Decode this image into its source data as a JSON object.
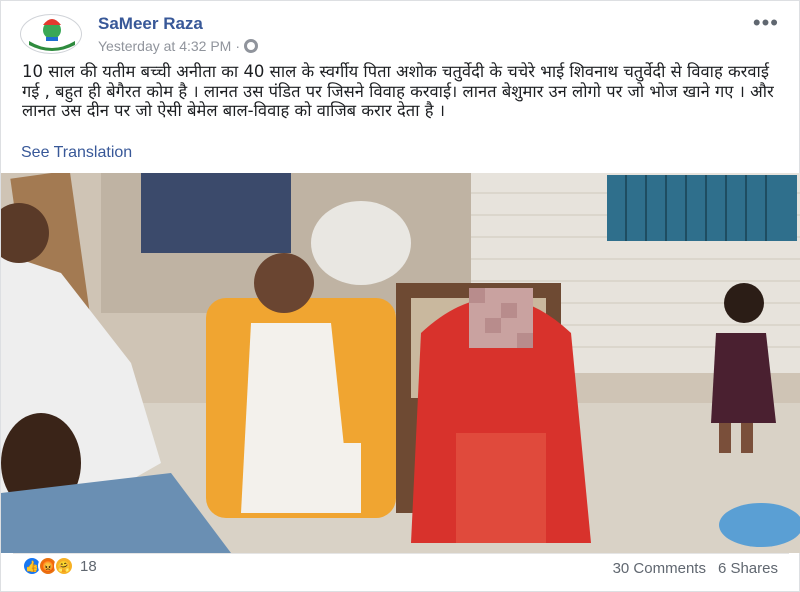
{
  "post": {
    "author": "SaMeer Raza",
    "timestamp": "Yesterday at 4:32 PM",
    "separator": "·",
    "privacy_icon": "globe-icon",
    "more_icon": "more-options-icon",
    "more_label": "•••",
    "text": "10 साल की यतीम बच्ची अनीता का 40 साल के स्वर्गीय पिता अशोक चतुर्वेदी के चचेरे भाई शिवनाथ चतुर्वेदी से विवाह करवाई गई , बहुत ही बेगैरत कोम है । लानत उस पंडित पर जिसने विवाह करवाई। लानत बेशुमार उन लोगो पर जो भोज खाने गए । और लानत उस दीन पर जो ऐसी बेमेल बाल-विवाह को वाजिब करार देता है ।",
    "see_translation": "See Translation"
  },
  "photo": {
    "icon": "post-photo"
  },
  "footer": {
    "reactions": [
      "like-reaction-icon",
      "angry-reaction-icon",
      "care-reaction-icon"
    ],
    "reaction_count": "18",
    "comments": "30 Comments",
    "shares": "6 Shares"
  },
  "colors": {
    "link": "#385898",
    "meta": "#90949c",
    "like": "#1877f2",
    "angry": "#e9710f",
    "care": "#f7b125"
  }
}
